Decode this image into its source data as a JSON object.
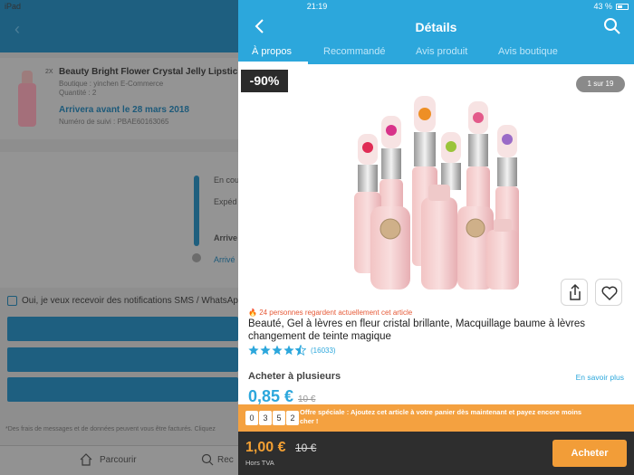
{
  "status": {
    "device": "iPad",
    "time": "21:19",
    "battery": "43 %"
  },
  "background": {
    "product_title": "Beauty Bright Flower Crystal Jelly Lipstick",
    "shop": "Boutique : yinchen E-Commerce",
    "quantity": "Quantité : 2",
    "arrival": "Arrivera avant le 28 mars 2018",
    "tracking": "Numéro de suivi : PBAE60163065",
    "tl_1": "En cou",
    "tl_2": "Expéd",
    "tl_3": "Arrive",
    "tl_4": "Arrivé",
    "notify_label": "Oui, je veux recevoir des notifications SMS / WhatsApp",
    "footnote": "*Des frais de messages et de données peuvent vous être facturés. Cliquez",
    "tab_browse": "Parcourir",
    "tab_search": "Rec"
  },
  "header": {
    "title": "Détails"
  },
  "tabs": [
    {
      "label": "À propos"
    },
    {
      "label": "Recommandé"
    },
    {
      "label": "Avis produit"
    },
    {
      "label": "Avis boutique"
    }
  ],
  "product": {
    "discount": "-90%",
    "image_counter": "1 sur 19",
    "watchers": "24 personnes regardent actuellement cet article",
    "title": "Beauté, Gel à lèvres en fleur cristal brillante, Macquillage baume à lèvres changement de teinte magique",
    "rating": 4.5,
    "reviews": "(16033)",
    "buy_multiple": "Acheter à plusieurs",
    "learn_more": "En savoir plus",
    "multi_price": "0,85 €",
    "multi_price_old": "10 €"
  },
  "offer": {
    "digits": [
      "0",
      "3",
      "5",
      "2"
    ],
    "text": "Offre spéciale : Ajoutez cet article à votre panier dès maintenant et payez encore moins cher !"
  },
  "bottom": {
    "price": "1,00 €",
    "price_old": "10 €",
    "vat": "Hors TVA",
    "buy_label": "Acheter"
  },
  "colors": {
    "accent": "#2ca7dc",
    "orange": "#f29d38",
    "dark": "#2e2e2e"
  }
}
